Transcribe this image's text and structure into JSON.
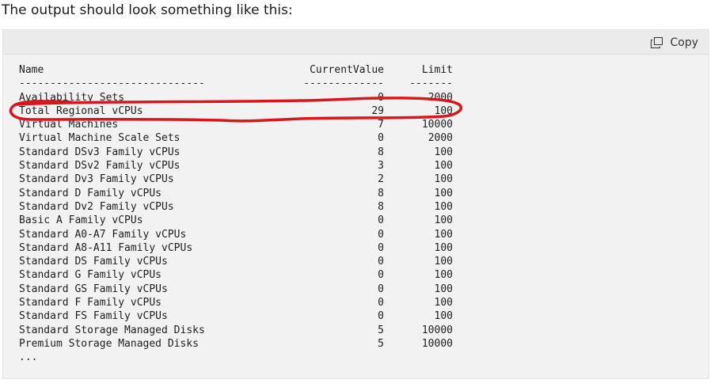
{
  "intro_text": "The output should look something like this:",
  "copy_label": "Copy",
  "header": {
    "name": "Name",
    "current": "CurrentValue",
    "limit": "Limit"
  },
  "separator": {
    "name": "------------------------------",
    "current": "-------------",
    "limit": "-------"
  },
  "rows": [
    {
      "name": "Availability Sets",
      "current": "0",
      "limit": "2000"
    },
    {
      "name": "Total Regional vCPUs",
      "current": "29",
      "limit": "100"
    },
    {
      "name": "Virtual Machines",
      "current": "7",
      "limit": "10000"
    },
    {
      "name": "Virtual Machine Scale Sets",
      "current": "0",
      "limit": "2000"
    },
    {
      "name": "Standard DSv3 Family vCPUs",
      "current": "8",
      "limit": "100"
    },
    {
      "name": "Standard DSv2 Family vCPUs",
      "current": "3",
      "limit": "100"
    },
    {
      "name": "Standard Dv3 Family vCPUs",
      "current": "2",
      "limit": "100"
    },
    {
      "name": "Standard D Family vCPUs",
      "current": "8",
      "limit": "100"
    },
    {
      "name": "Standard Dv2 Family vCPUs",
      "current": "8",
      "limit": "100"
    },
    {
      "name": "Basic A Family vCPUs",
      "current": "0",
      "limit": "100"
    },
    {
      "name": "Standard A0-A7 Family vCPUs",
      "current": "0",
      "limit": "100"
    },
    {
      "name": "Standard A8-A11 Family vCPUs",
      "current": "0",
      "limit": "100"
    },
    {
      "name": "Standard DS Family vCPUs",
      "current": "0",
      "limit": "100"
    },
    {
      "name": "Standard G Family vCPUs",
      "current": "0",
      "limit": "100"
    },
    {
      "name": "Standard GS Family vCPUs",
      "current": "0",
      "limit": "100"
    },
    {
      "name": "Standard F Family vCPUs",
      "current": "0",
      "limit": "100"
    },
    {
      "name": "Standard FS Family vCPUs",
      "current": "0",
      "limit": "100"
    },
    {
      "name": "Standard Storage Managed Disks",
      "current": "5",
      "limit": "10000"
    },
    {
      "name": "Premium Storage Managed Disks",
      "current": "5",
      "limit": "10000"
    }
  ],
  "ellipsis": "...",
  "highlight_color": "#d9161b"
}
